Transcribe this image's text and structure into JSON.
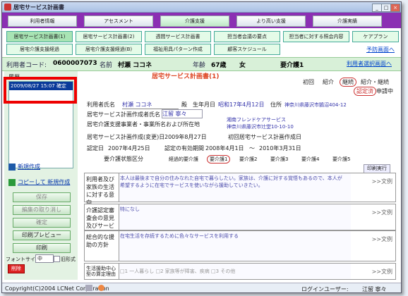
{
  "window": {
    "title": "居宅サービス計画書"
  },
  "tabs": [
    {
      "label": "利用者情報"
    },
    {
      "label": "アセスメント"
    },
    {
      "label": "介護支援"
    },
    {
      "label": "より高い支援"
    },
    {
      "label": "介護実績"
    }
  ],
  "subtabs": [
    {
      "label": "居宅サービス計画書(1)"
    },
    {
      "label": "居宅サービス計画書(2)"
    },
    {
      "label": "週間サービス計画書"
    },
    {
      "label": "担当者会議の要点"
    },
    {
      "label": "担当者に対する照会内容"
    },
    {
      "label": "ケアプラン"
    },
    {
      "label": "居宅介護支援経過"
    },
    {
      "label": "居宅介護支援経過(B)"
    },
    {
      "label": "福祉用具パターン作成"
    },
    {
      "label": "顧客スケジュール"
    }
  ],
  "links": {
    "prev": "予防画面へ",
    "select": "利用者選択画面へ"
  },
  "info": {
    "code_label": "利用者コード:",
    "code": "0600007073",
    "name_label": "名前",
    "name": "村瀬 ココネ",
    "age_label": "年齢",
    "age": "67歳",
    "sex": "女",
    "care_level": "要介護1"
  },
  "doc_title": "居宅サービス計画書(1)",
  "left": {
    "history_label": "履歴",
    "history_items": [
      "2009/08/27 15:07 確定"
    ],
    "new": "新規作成",
    "copy_new": "コピーして 新規作成",
    "save": "保存",
    "cancel_edit": "編集の取り消し",
    "confirm": "確定",
    "print_preview": "印刷プレビュー",
    "print": "印刷",
    "font_size_label": "フォントサイズ",
    "font_size": "中",
    "old_format": "旧形式",
    "delete": "削除"
  },
  "status": {
    "first": "初回",
    "intro": "紹介",
    "continue": "継続",
    "intro_continue": "紹介・継続",
    "certified": "認定済",
    "applying": "申請中"
  },
  "form": {
    "user_label": "利用者氏名",
    "user": "村瀬 ココネ",
    "honor": "殿",
    "birth_label": "生年月日",
    "birth": "昭和17年4月12日",
    "addr_label": "住所",
    "addr": "神奈川県藤沢市鵠沼404-12",
    "planner_label": "居宅サービス計画作成者氏名",
    "planner": "江留 寧々",
    "office_label": "居宅介護支援事業者・事業所名および所在地",
    "office": "湘南フレンドケアサービス",
    "office_addr": "神奈川県藤沢市辻堂10-10-10",
    "date_label": "居宅サービス計画作成(変更)日",
    "date": "2009年8月27日",
    "first_date_label": "初回居宅サービス計画作成日",
    "cert_label": "認定日",
    "cert": "2007年4月25日",
    "valid_label": "認定の有効期間",
    "valid_from": "2008年4月1日",
    "valid_sep": "～",
    "valid_to": "2010年3月31日",
    "level_label": "要介護状態区分",
    "levels": [
      "経過的要介護",
      "要介護1",
      "要介護2",
      "要介護3",
      "要介護4",
      "要介護5"
    ],
    "print_btn": "印刷実行"
  },
  "sections": [
    {
      "label": "利用者及び家族の生活に対する意向",
      "text": "本人は最後まで自分の住みなれた自宅で暮らしたい。家族は、介護に対する覚悟もあるので、本人が希望するように在宅でサービスを使いながら援助していきたい。",
      "side": ">>文例"
    },
    {
      "label": "介護認定審査会の意見及びサービスの種類の指定",
      "text": "特になし",
      "side": ">>文例"
    },
    {
      "label": "総合的な援助の方針",
      "text": "在宅生活を存続するために色々なサービスを利用する",
      "side": ">>文例"
    },
    {
      "label": "生活援助中心型の算定理由",
      "text": "□1 一人暮らし □2 家族等が障害、疾病 □3 その他",
      "side": ">>文例"
    }
  ],
  "footer": {
    "copyright": "Copyright(C)2004 LCNet Corporation",
    "login_label": "ログインユーザー:",
    "login": "江留 寧々"
  }
}
